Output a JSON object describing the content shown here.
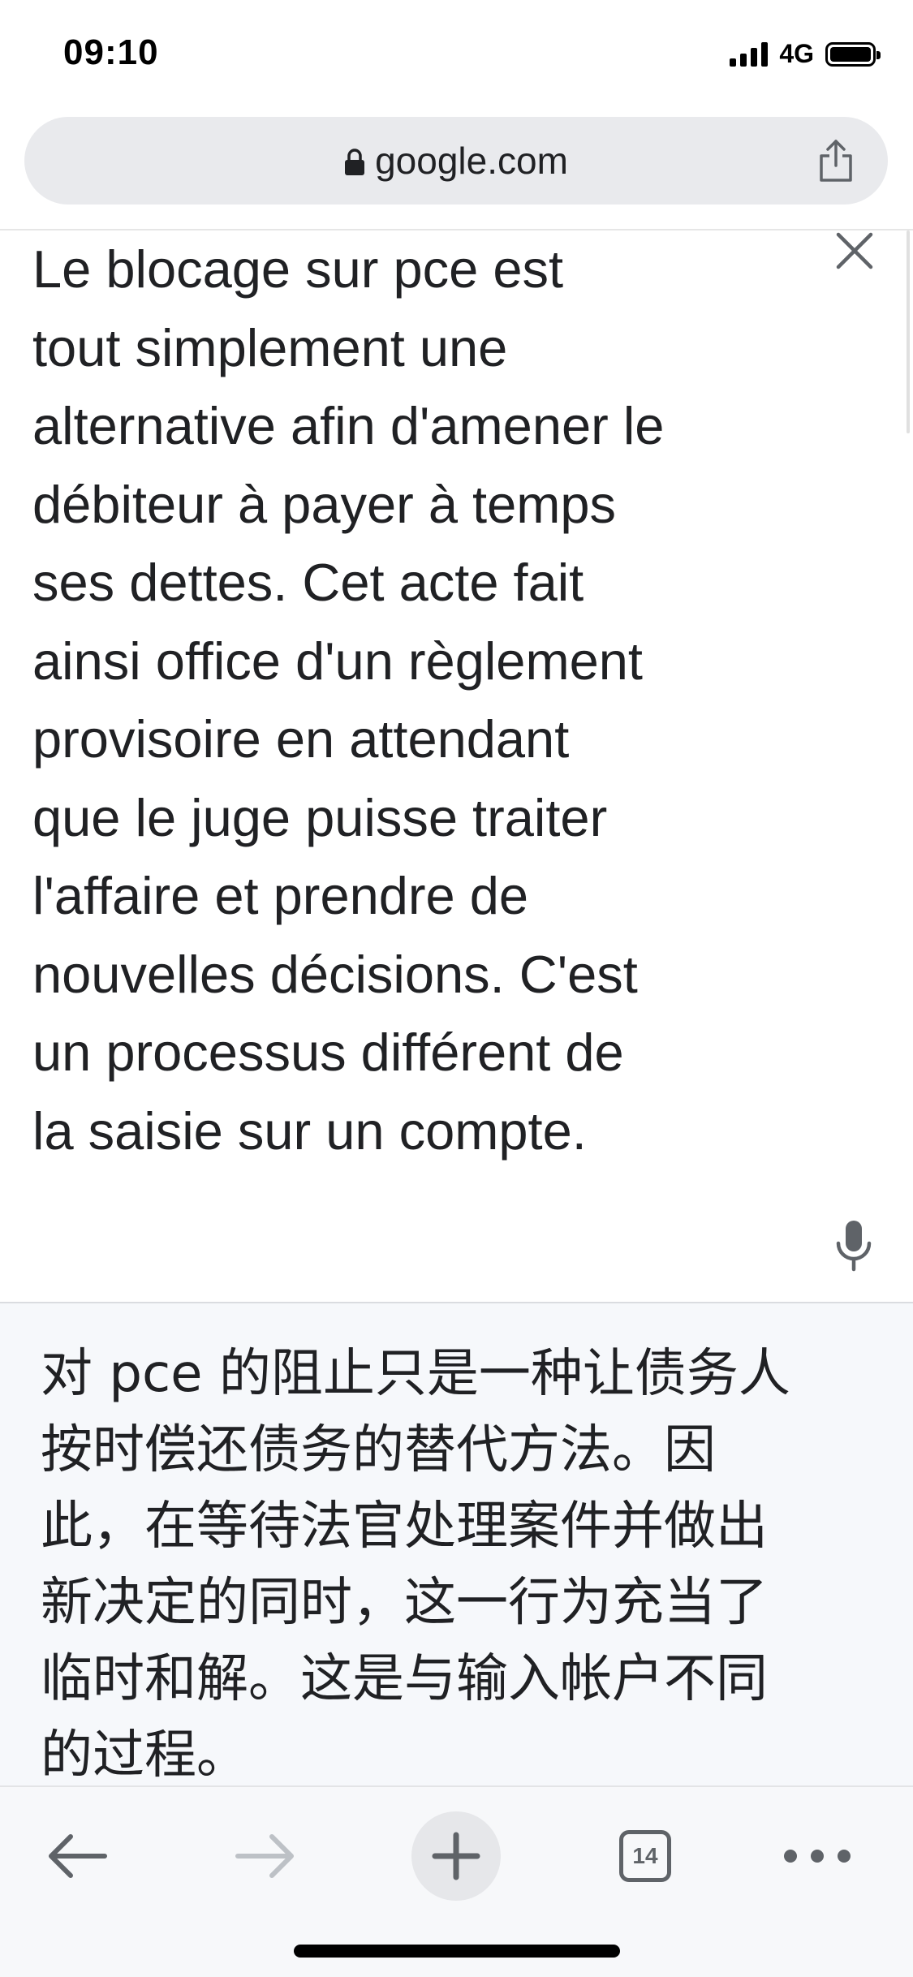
{
  "status_bar": {
    "time": "09:10",
    "network": "4G"
  },
  "browser": {
    "url": "google.com",
    "tab_count": "14"
  },
  "translation": {
    "source_text": "Le blocage sur pce est tout simplement une alternative afin d'amener le débiteur à payer à temps ses dettes. Cet acte fait ainsi office d'un règlement provisoire en attendant que le juge puisse traiter l'affaire et prendre de nouvelles décisions. C'est un processus différent de la saisie sur un compte.",
    "source_lines": [
      "Le blocage sur pce est",
      "tout simplement une",
      "alternative afin d'amener le",
      "débiteur à payer à temps",
      "ses dettes. Cet acte fait",
      "ainsi office d'un règlement",
      "provisoire en attendant",
      "que le juge puisse traiter",
      "l'affaire et prendre de",
      "nouvelles décisions. C'est",
      "un processus différent de",
      "la saisie sur un compte."
    ],
    "target_lines": [
      "对 pce 的阻止只是一种让债务人",
      "按时偿还债务的替代方法。因",
      "此，在等待法官处理案件并做出",
      "新决定的同时，这一行为充当了",
      "临时和解。这是与输入帐户不同",
      "的过程。"
    ]
  },
  "icons": {
    "lock": "lock-icon",
    "share": "share-icon",
    "close": "close-icon",
    "mic": "microphone-icon",
    "back": "back-arrow-icon",
    "forward": "forward-arrow-icon",
    "new_tab": "plus-icon",
    "tabs": "tab-switcher-icon",
    "more": "more-dots-icon"
  },
  "colors": {
    "url_bar_bg": "#e9eaed",
    "target_panel_bg": "#f6f8fb",
    "icon_gray": "#5f6368",
    "disabled_gray": "#bdc1c6"
  }
}
